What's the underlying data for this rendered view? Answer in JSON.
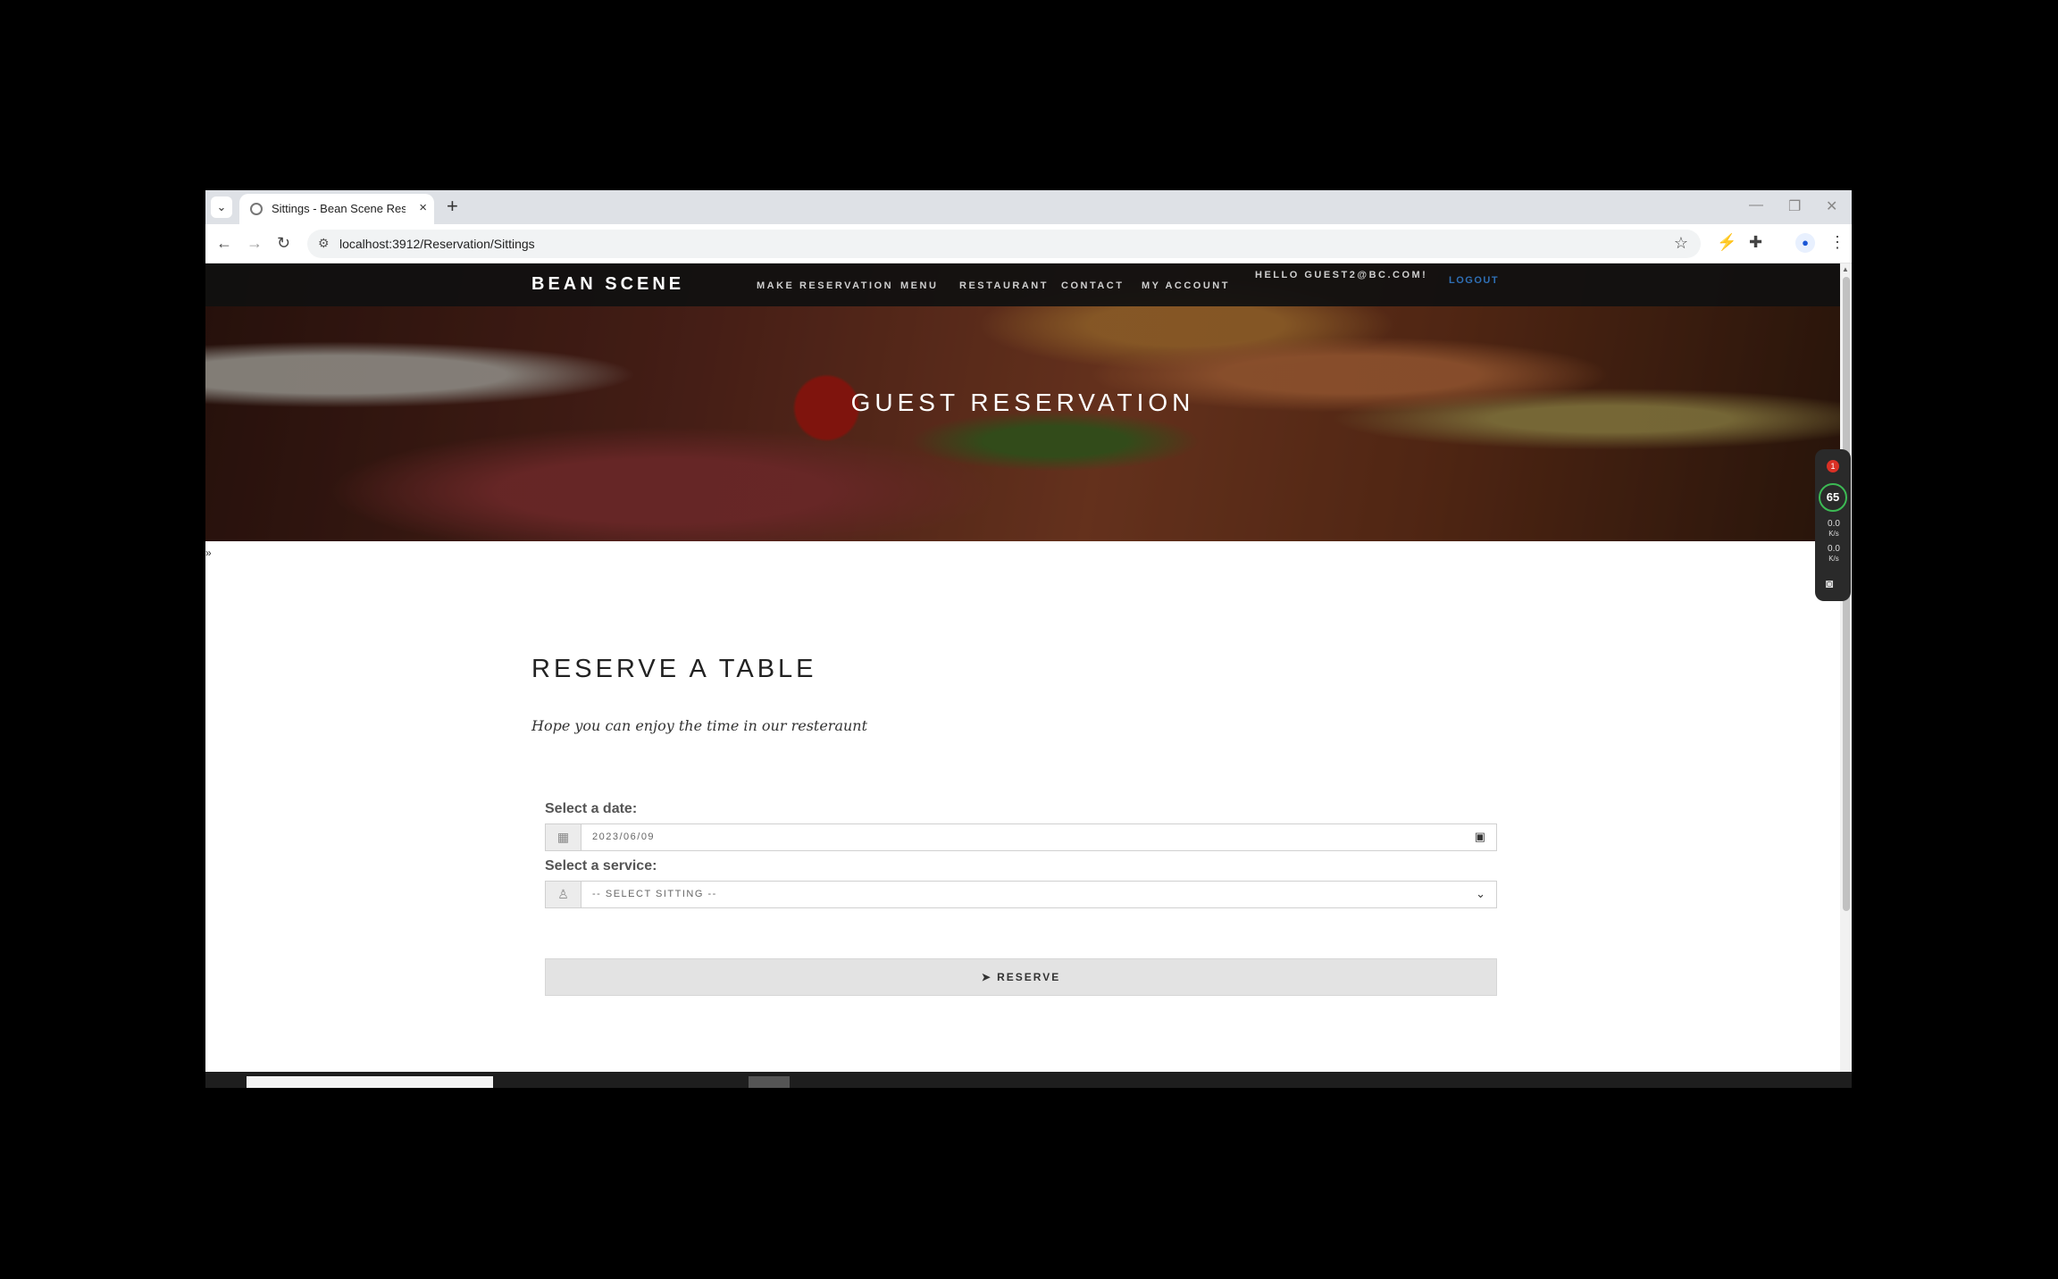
{
  "browser": {
    "tab_title": "Sittings - Bean Scene Restaurant",
    "new_tab": "+",
    "close": "×",
    "url": "localhost:3912/Reservation/Sittings"
  },
  "site": {
    "brand": "BEAN SCENE",
    "nav": [
      "MAKE RESERVATION",
      "MENU",
      "RESTAURANT",
      "CONTACT",
      "MY ACCOUNT"
    ],
    "hello": "HELLO GUEST2@BC.COM!",
    "logout": "LOGOUT"
  },
  "hero": {
    "title": "GUEST RESERVATION"
  },
  "section": {
    "title": "RESERVE A TABLE",
    "subtitle": "Hope you can enjoy the time in our resteraunt"
  },
  "form": {
    "date_label": "Select a date:",
    "date_value": "2023/06/09",
    "service_label": "Select a service:",
    "service_value": "-- SELECT SITTING --",
    "submit_label": "RESERVE"
  },
  "widget": {
    "badge": "1",
    "percent": "65",
    "up_rate": "0.0",
    "down_rate": "0.0",
    "unit": "K/s"
  },
  "colors": {
    "navbar": "#101010",
    "logout_link": "#2f6fb5",
    "button_bg": "#e3e3e3"
  }
}
